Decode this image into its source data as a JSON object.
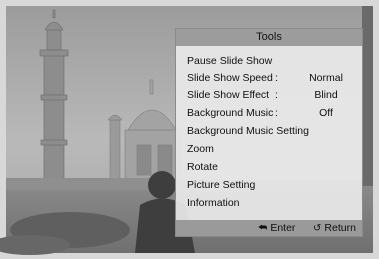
{
  "panel": {
    "title": "Tools",
    "items": [
      {
        "label": "Pause Slide Show"
      },
      {
        "label": "Slide Show Speed",
        "sep": ":",
        "value": "Normal"
      },
      {
        "label": "Slide Show Effect",
        "sep": ":",
        "value": "Blind"
      },
      {
        "label": "Background Music",
        "sep": ":",
        "value": "Off"
      },
      {
        "label": "Background Music Setting"
      },
      {
        "label": "Zoom"
      },
      {
        "label": "Rotate"
      },
      {
        "label": "Picture Setting"
      },
      {
        "label": "Information"
      }
    ],
    "footer": {
      "enter_label": "Enter",
      "return_label": "Return",
      "enter_icon": "enter-icon",
      "return_icon": "return-icon"
    }
  },
  "colors": {
    "panel_bg": "#e8e8e8",
    "title_bar": "#9c9c9c",
    "footer_bar": "#9a9a9a"
  }
}
